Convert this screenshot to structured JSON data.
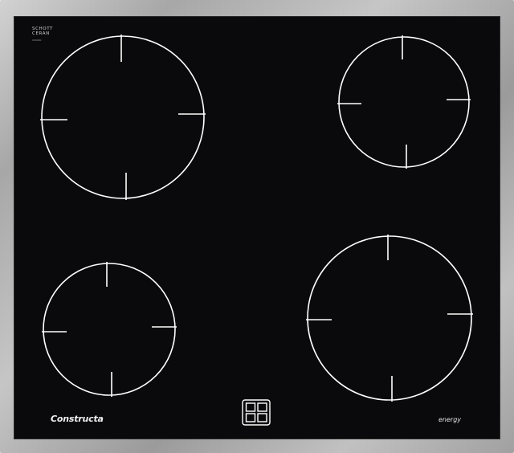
{
  "product": {
    "glass_logo_line1": "SCHOTT",
    "glass_logo_line2": "CERAN",
    "glass_logo_fine": "000000",
    "brand": "Constructa",
    "label_right": "energy"
  },
  "burners": [
    {
      "name": "burner-rear-left",
      "size": "large"
    },
    {
      "name": "burner-rear-right",
      "size": "medium"
    },
    {
      "name": "burner-front-left",
      "size": "medium"
    },
    {
      "name": "burner-front-right",
      "size": "large"
    }
  ],
  "colors": {
    "glass": "#0a0a0c",
    "markings": "#ffffff",
    "frame": "#b5b5b5"
  }
}
